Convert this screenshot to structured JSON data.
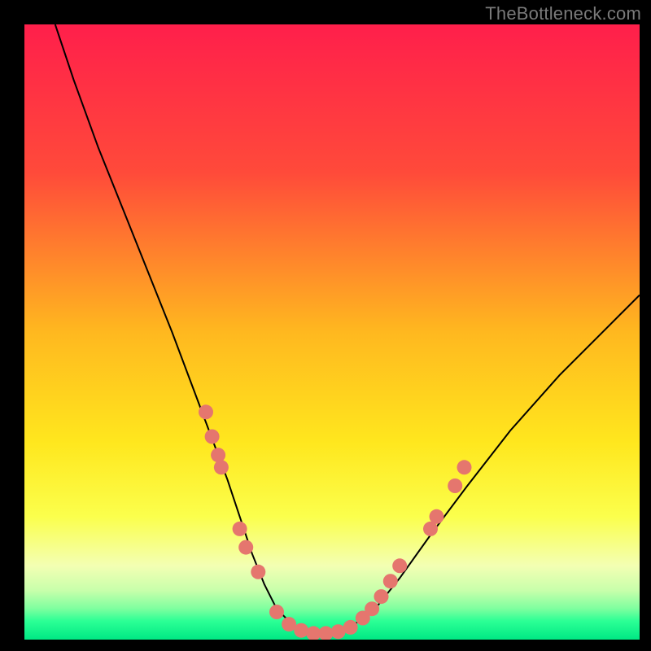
{
  "watermark": "TheBottleneck.com",
  "chart_data": {
    "type": "line",
    "title": "",
    "xlabel": "",
    "ylabel": "",
    "xlim": [
      0,
      100
    ],
    "ylim": [
      0,
      100
    ],
    "grid": false,
    "series": [
      {
        "name": "bottleneck-curve",
        "x": [
          5,
          8,
          12,
          16,
          20,
          24,
          27,
          30,
          33,
          35,
          37,
          39,
          41,
          44,
          47,
          50,
          53,
          57,
          61,
          66,
          72,
          79,
          87,
          95,
          100
        ],
        "values": [
          100,
          91,
          80,
          70,
          60,
          50,
          42,
          34,
          26,
          20,
          14,
          9,
          5,
          2,
          1,
          1,
          2,
          5,
          10,
          17,
          25,
          34,
          43,
          51,
          56
        ]
      }
    ],
    "dot_clusters": [
      {
        "name": "left-upper-dots",
        "points": [
          [
            29.5,
            37
          ],
          [
            30.5,
            33
          ],
          [
            31.5,
            30
          ],
          [
            32,
            28
          ]
        ]
      },
      {
        "name": "left-lower-dots",
        "points": [
          [
            35,
            18
          ],
          [
            36,
            15
          ],
          [
            38,
            11
          ]
        ]
      },
      {
        "name": "bottom-dots",
        "points": [
          [
            41,
            4.5
          ],
          [
            43,
            2.5
          ],
          [
            45,
            1.5
          ],
          [
            47,
            1
          ],
          [
            49,
            1
          ],
          [
            51,
            1.3
          ],
          [
            53,
            2
          ]
        ]
      },
      {
        "name": "right-lower-dots",
        "points": [
          [
            55,
            3.5
          ],
          [
            56.5,
            5
          ],
          [
            58,
            7
          ],
          [
            59.5,
            9.5
          ],
          [
            61,
            12
          ]
        ]
      },
      {
        "name": "right-upper-dots",
        "points": [
          [
            66,
            18
          ],
          [
            67,
            20
          ],
          [
            70,
            25
          ],
          [
            71.5,
            28
          ]
        ]
      }
    ],
    "gradient_stops": [
      {
        "pos": 0,
        "color": "#ff1f4b"
      },
      {
        "pos": 24,
        "color": "#ff4a3a"
      },
      {
        "pos": 50,
        "color": "#ffb81f"
      },
      {
        "pos": 68,
        "color": "#ffe71e"
      },
      {
        "pos": 80,
        "color": "#fbff4c"
      },
      {
        "pos": 88,
        "color": "#f3ffb3"
      },
      {
        "pos": 92,
        "color": "#c8ffab"
      },
      {
        "pos": 95,
        "color": "#7dff9f"
      },
      {
        "pos": 97,
        "color": "#2bff95"
      },
      {
        "pos": 100,
        "color": "#00e884"
      }
    ],
    "dot_color": "#e5766e",
    "dot_radius": 9,
    "curve_stroke": "#000000",
    "curve_width": 2
  }
}
